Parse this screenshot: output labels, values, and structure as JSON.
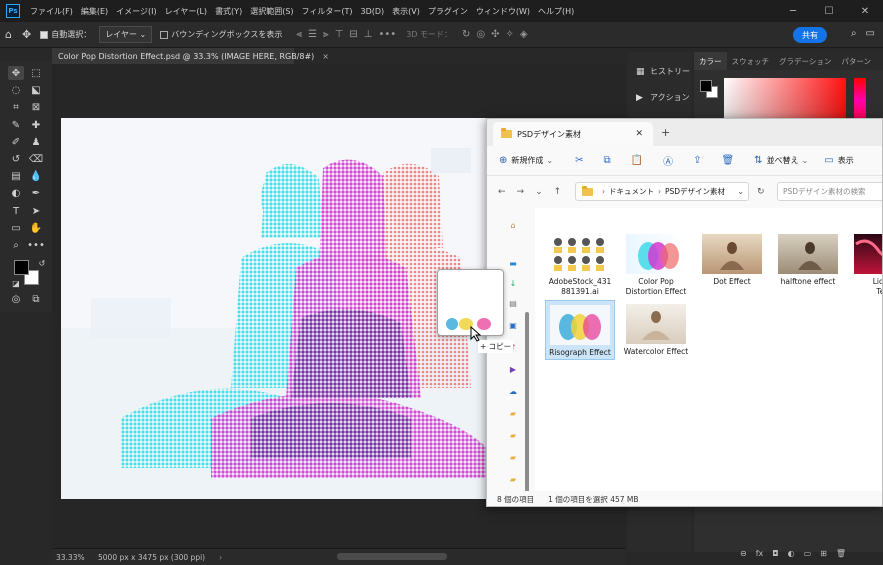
{
  "menubar": {
    "items": [
      "ファイル(F)",
      "編集(E)",
      "イメージ(I)",
      "レイヤー(L)",
      "書式(Y)",
      "選択範囲(S)",
      "フィルター(T)",
      "3D(D)",
      "表示(V)",
      "プラグイン",
      "ウィンドウ(W)",
      "ヘルプ(H)"
    ],
    "logo": "Ps"
  },
  "options": {
    "auto_select_label": "自動選択：",
    "layer_select": "レイヤー",
    "bounding_box_label": "バウンディングボックスを表示",
    "mode3d_label": "3D モード：",
    "share_label": "共有"
  },
  "document": {
    "tab_title": "Color Pop Distortion Effect.psd @ 33.3% (IMAGE HERE, RGB/8#)",
    "zoom": "33.33%",
    "dimensions": "5000 px x 3475 px (300 ppi)"
  },
  "panels": {
    "history_label": "ヒストリー",
    "actions_label": "アクション",
    "tabs": [
      "カラー",
      "スウォッチ",
      "グラデーション",
      "パターン"
    ]
  },
  "explorer": {
    "tab_title": "PSDデザイン素材",
    "new_label": "新規作成",
    "sort_label": "並べ替え",
    "view_label": "表示",
    "breadcrumb": [
      "ドキュメント",
      "PSDデザイン素材"
    ],
    "search_placeholder": "PSDデザイン素材の検索",
    "files": [
      {
        "name": "AdobeStock_431881391.ai",
        "line1": "AdobeStock_431",
        "line2": "881391.ai",
        "selected": false
      },
      {
        "name": "Color Pop Distortion Effect",
        "line1": "Color Pop",
        "line2": "Distortion Effect",
        "selected": false
      },
      {
        "name": "Dot Effect",
        "line1": "Dot Effect",
        "line2": "",
        "selected": false
      },
      {
        "name": "halftone effect",
        "line1": "halftone effect",
        "line2": "",
        "selected": false
      },
      {
        "name": "Liquid Text",
        "line1": "Liquid",
        "line2": "Text",
        "selected": false
      },
      {
        "name": "Risograph Effect",
        "line1": "Risograph Effect",
        "line2": "",
        "selected": true
      },
      {
        "name": "Watercolor Effect",
        "line1": "Watercolor Effect",
        "line2": "",
        "selected": false
      }
    ],
    "status_count": "8 個の項目",
    "status_selected": "1 個の項目を選択  457 MB"
  },
  "drag": {
    "copy_label": "+ コピー"
  },
  "colors": {
    "accent": "#1473e6",
    "cyan": "#38e0ec",
    "magenta": "#e83ccf",
    "coral": "#f06a66"
  }
}
